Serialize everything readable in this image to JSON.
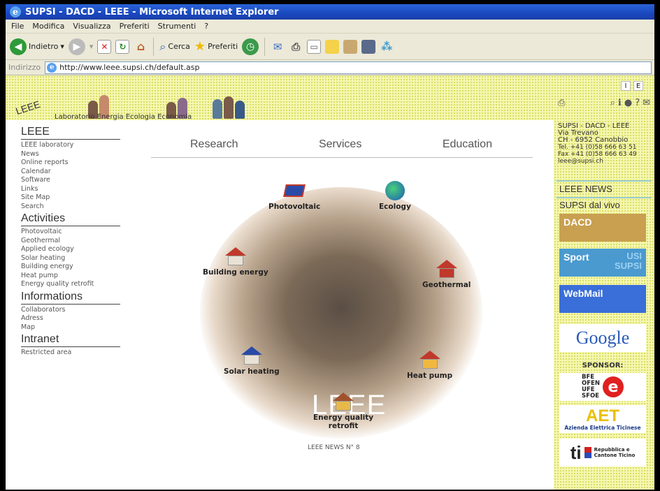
{
  "window": {
    "title": "SUPSI - DACD - LEEE - Microsoft Internet Explorer"
  },
  "menu": [
    "File",
    "Modifica",
    "Visualizza",
    "Preferiti",
    "Strumenti",
    "?"
  ],
  "toolbar": {
    "back_label": "Indietro",
    "search_label": "Cerca",
    "favorites_label": "Preferiti"
  },
  "address": {
    "label": "Indirizzo",
    "url": "http://www.leee.supsi.ch/default.asp"
  },
  "header": {
    "logo": "LEEE",
    "tagline": "Laboratorio Energia Ecologia Economia",
    "lang_i": "I",
    "lang_e": "E"
  },
  "topnav": [
    "Research",
    "Services",
    "Education"
  ],
  "sidebar": {
    "sections": [
      {
        "title": "LEEE",
        "items": [
          "LEEE laboratory",
          "News",
          "Online reports",
          "Calendar",
          "Software",
          "Links",
          "Site Map",
          "Search"
        ]
      },
      {
        "title": "Activities",
        "items": [
          "Photovoltaic",
          "Geothermal",
          "Applied ecology",
          "Solar heating",
          "Building energy",
          "Heat pump",
          "Energy quality retrofit"
        ]
      },
      {
        "title": "Informations",
        "items": [
          "Collaborators",
          "Adress",
          "Map"
        ]
      },
      {
        "title": "Intranet",
        "items": [
          "Restricted area"
        ]
      }
    ]
  },
  "hero": {
    "label": "LEEE",
    "activities": {
      "photovoltaic": "Photovoltaic",
      "ecology": "Ecology",
      "building": "Building energy",
      "geothermal": "Geothermal",
      "solar": "Solar heating",
      "heatpump": "Heat pump",
      "retrofit_1": "Energy quality",
      "retrofit_2": "retrofit"
    }
  },
  "news_footer": "LEEE NEWS N° 8",
  "contact": {
    "line1": "SUPSI - DACD - LEEE",
    "line2": "Via Trevano",
    "line3": "CH - 6952 Canobbio",
    "tel": "Tel. +41 (0)58 666 63 51",
    "fax": "Fax +41 (0)58 666 63 49",
    "email": "leee@supsi.ch"
  },
  "rightcol": {
    "news_link": "LEEE NEWS",
    "dal_vivo": "SUPSI dal vivo",
    "dacd": "DACD",
    "sport": "Sport",
    "usi": "USI",
    "supsi": "SUPSI",
    "webmail": "WebMail",
    "google": "Google",
    "sponsor": "SPONSOR:",
    "bfe_1": "BFE",
    "bfe_2": "OFEN",
    "bfe_3": "UFE",
    "bfe_4": "SFOE",
    "aet": "AET",
    "aet_sub": "Azienda Elettrica Ticinese",
    "ti": "ti",
    "ti_sub1": "Repubblica e",
    "ti_sub2": "Cantone Ticino"
  },
  "colors": {
    "title_bar": "#1a48c0",
    "header_yellow": "#f5f7b0",
    "dacd": "#c8a050",
    "sport": "#4a9ad0",
    "webmail": "#3a6ed8"
  }
}
